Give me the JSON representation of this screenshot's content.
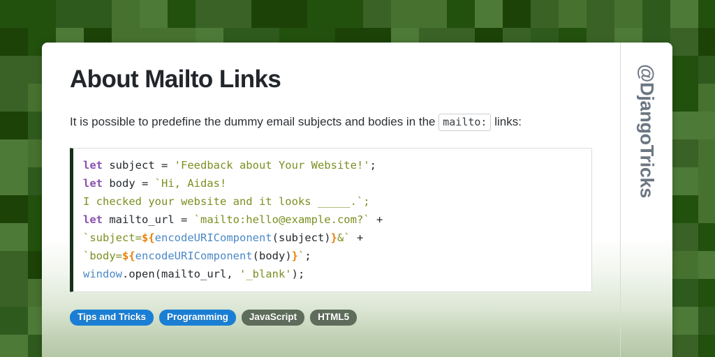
{
  "background": {
    "name": "green-checkerboard",
    "tile_size_px": 40,
    "palette": [
      "#47712f",
      "#4e7a38",
      "#3a6226",
      "#1c4208",
      "#22500d",
      "#2f5a1e"
    ]
  },
  "card": {
    "brand_handle": "@DjangoTricks",
    "title": "About Mailto Links",
    "paragraph": {
      "before_code": "It is possible to predefine the dummy email subjects and bodies in the ",
      "inline_code": "mailto:",
      "after_code": " links:"
    },
    "code_block": {
      "language": "javascript",
      "lines": [
        [
          {
            "t": "let",
            "c": "kw"
          },
          {
            "t": " subject = ",
            "c": "plain"
          },
          {
            "t": "'Feedback about Your Website!'",
            "c": "str"
          },
          {
            "t": ";",
            "c": "plain"
          }
        ],
        [
          {
            "t": "let",
            "c": "kw"
          },
          {
            "t": " body = ",
            "c": "plain"
          },
          {
            "t": "`Hi, Aidas!",
            "c": "str"
          }
        ],
        [
          {
            "t": "I checked your website and it looks _____.`;",
            "c": "str"
          }
        ],
        [
          {
            "t": "let",
            "c": "kw"
          },
          {
            "t": " mailto_url = ",
            "c": "plain"
          },
          {
            "t": "`mailto:hello@example.com?`",
            "c": "str"
          },
          {
            "t": " +",
            "c": "plain"
          }
        ],
        [
          {
            "t": "`subject=",
            "c": "str"
          },
          {
            "t": "${",
            "c": "tpl"
          },
          {
            "t": "encodeURIComponent",
            "c": "fn"
          },
          {
            "t": "(subject)",
            "c": "plain"
          },
          {
            "t": "}",
            "c": "tpl"
          },
          {
            "t": "&`",
            "c": "str"
          },
          {
            "t": " +",
            "c": "plain"
          }
        ],
        [
          {
            "t": "`body=",
            "c": "str"
          },
          {
            "t": "${",
            "c": "tpl"
          },
          {
            "t": "encodeURIComponent",
            "c": "fn"
          },
          {
            "t": "(body)",
            "c": "plain"
          },
          {
            "t": "}",
            "c": "tpl"
          },
          {
            "t": "`",
            "c": "str"
          },
          {
            "t": ";",
            "c": "plain"
          }
        ],
        [
          {
            "t": "window",
            "c": "var"
          },
          {
            "t": ".open(mailto_url, ",
            "c": "plain"
          },
          {
            "t": "'_blank'",
            "c": "str"
          },
          {
            "t": ");",
            "c": "plain"
          }
        ]
      ],
      "plain_text": "let subject = 'Feedback about Your Website!';\nlet body = `Hi, Aidas!\nI checked your website and it looks _____.`;\nlet mailto_url = `mailto:hello@example.com?` +\n`subject=${encodeURIComponent(subject)}&` +\n`body=${encodeURIComponent(body)}`;\nwindow.open(mailto_url, '_blank');"
    },
    "tags": [
      {
        "label": "Tips and Tricks",
        "style": "primary",
        "color": "#1a7fd4"
      },
      {
        "label": "Programming",
        "style": "primary",
        "color": "#1a7fd4"
      },
      {
        "label": "JavaScript",
        "style": "secondary",
        "color": "#5e6d5b"
      },
      {
        "label": "HTML5",
        "style": "secondary",
        "color": "#5e6d5b"
      }
    ]
  }
}
